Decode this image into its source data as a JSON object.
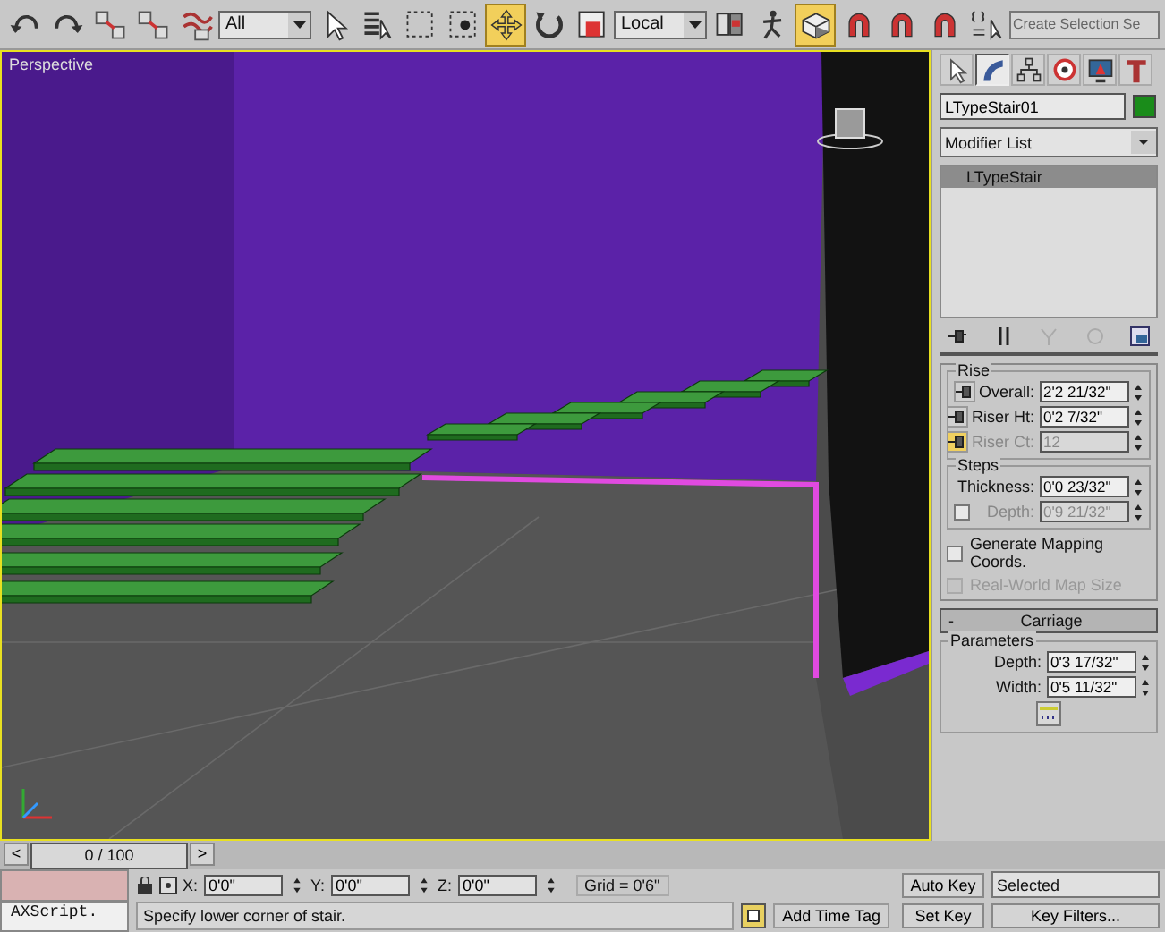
{
  "toolbar": [
    {
      "kind": "icon",
      "selected": false
    },
    {
      "kind": "icon",
      "selected": false
    },
    {
      "kind": "icon",
      "selected": false
    },
    {
      "kind": "icon",
      "selected": false
    },
    {
      "kind": "icon",
      "selected": false
    },
    {
      "kind": "dropdown",
      "value": "All"
    },
    {
      "kind": "icon",
      "selected": false
    },
    {
      "kind": "icon",
      "selected": false
    },
    {
      "kind": "icon",
      "selected": false
    },
    {
      "kind": "icon",
      "selected": false
    },
    {
      "kind": "icon",
      "selected": true
    },
    {
      "kind": "icon",
      "selected": false
    },
    {
      "kind": "icon",
      "selected": false
    },
    {
      "kind": "dropdown",
      "value": "Local"
    },
    {
      "kind": "icon",
      "selected": false
    },
    {
      "kind": "icon",
      "selected": false
    },
    {
      "kind": "icon",
      "selected": true
    },
    {
      "kind": "icon",
      "selected": false
    },
    {
      "kind": "icon",
      "selected": false
    },
    {
      "kind": "icon",
      "selected": false
    },
    {
      "kind": "icon",
      "selected": false
    },
    {
      "kind": "field",
      "placeholder": "Create Selection Se"
    }
  ],
  "viewport": {
    "label": "Perspective"
  },
  "command_panel": {
    "tabs": [
      {
        "selected": false
      },
      {
        "selected": true
      },
      {
        "selected": false
      },
      {
        "selected": false
      },
      {
        "selected": false
      },
      {
        "selected": false
      }
    ],
    "object_name": "LTypeStair01",
    "modifier_list": "Modifier List",
    "stack": [
      {
        "label": "LTypeStair",
        "selected": true
      }
    ],
    "rise": {
      "title": "Rise",
      "fields": [
        {
          "label": "Overall:",
          "value": "2'2 21/32\"",
          "disabled": false,
          "selected": false
        },
        {
          "label": "Riser Ht:",
          "value": "0'2 7/32\"",
          "disabled": false,
          "selected": false
        },
        {
          "label": "Riser Ct:",
          "value": "12",
          "disabled": true,
          "selected": true
        }
      ]
    },
    "steps": {
      "title": "Steps",
      "fields": [
        {
          "label": "Thickness:",
          "value": "0'0 23/32\"",
          "disabled": false
        },
        {
          "label": "Depth:",
          "value": "0'9 21/32\"",
          "disabled": true,
          "checked": false
        }
      ]
    },
    "options": [
      {
        "label": "Generate Mapping Coords.",
        "checked": false,
        "disabled": false
      },
      {
        "label": "Real-World Map Size",
        "checked": false,
        "disabled": true
      }
    ],
    "carriage": {
      "toggle": "-",
      "title": "Carriage",
      "group": "Parameters",
      "fields": [
        {
          "label": "Depth:",
          "value": "0'3 17/32\""
        },
        {
          "label": "Width:",
          "value": "0'5 11/32\""
        }
      ]
    }
  },
  "timeslider": {
    "prev": "<",
    "position": "0 / 100",
    "next": ">",
    "level": 0
  },
  "status": {
    "listener": "AXScript.",
    "prompt": "Specify lower corner of stair.",
    "x_label": "X:",
    "x": "0'0\"",
    "y_label": "Y:",
    "y": "0'0\"",
    "z_label": "Z:",
    "z": "0'0\"",
    "grid": "Grid = 0'6\"",
    "add_time_tag": "Add Time Tag",
    "auto_key": "Auto Key",
    "set_key": "Set Key",
    "key_mode": "Selected",
    "key_filters": "Key Filters..."
  }
}
